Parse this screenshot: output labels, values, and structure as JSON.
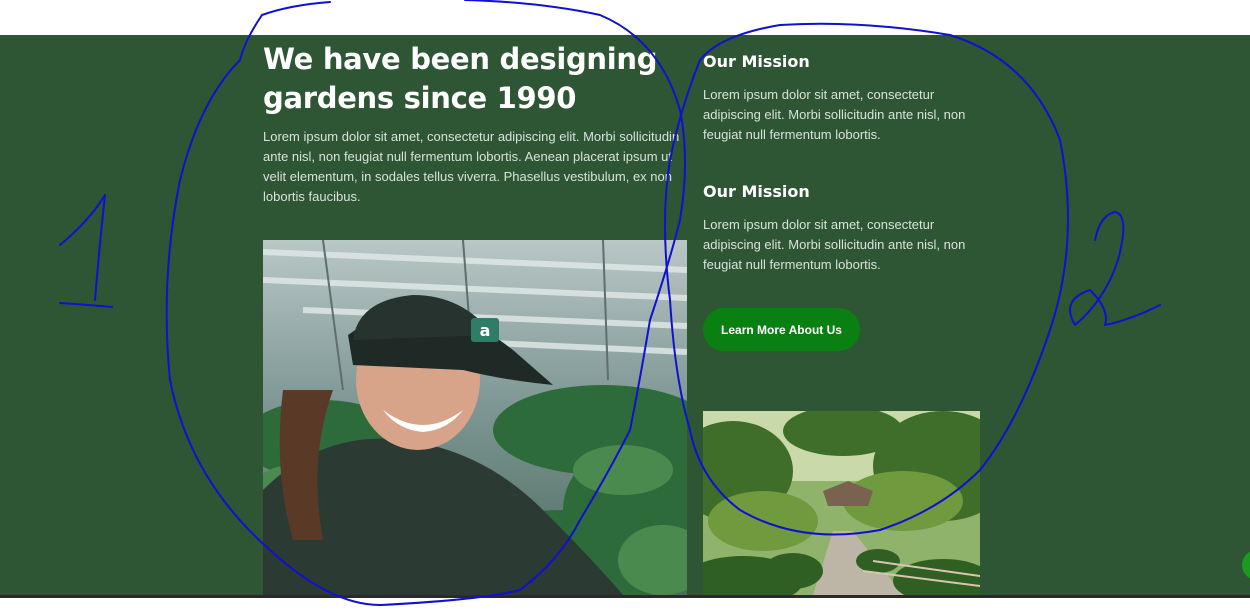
{
  "hero": {
    "heading": "We have been designing gardens since 1990",
    "intro": "Lorem ipsum dolor sit amet, consectetur adipiscing elit. Morbi sollicitudin ante nisl, non feugiat null fermentum lobortis. Aenean placerat ipsum ut velit elementum, in sodales tellus viverra. Phasellus vestibulum, ex non lobortis faucibus."
  },
  "missions": [
    {
      "title": "Our Mission",
      "text": "Lorem ipsum dolor sit amet, consectetur adipiscing elit. Morbi sollicitudin ante nisl, non feugiat null fermentum lobortis."
    },
    {
      "title": "Our Mission",
      "text": "Lorem ipsum dolor sit amet, consectetur adipiscing elit. Morbi sollicitudin ante nisl, non feugiat null fermentum lobortis."
    }
  ],
  "cta": {
    "label": "Learn More About Us"
  },
  "images": {
    "woman_photo": "gardener-in-greenhouse",
    "garden_photo": "japanese-garden-path",
    "cap_logo": "a"
  },
  "annotations": {
    "label_1": "1",
    "label_2": "2",
    "ink_color": "#1010d0"
  },
  "colors": {
    "section_bg": "#2f5634",
    "button_bg": "#0b8012",
    "text": "#ffffff",
    "muted_text": "#d9e2da"
  }
}
